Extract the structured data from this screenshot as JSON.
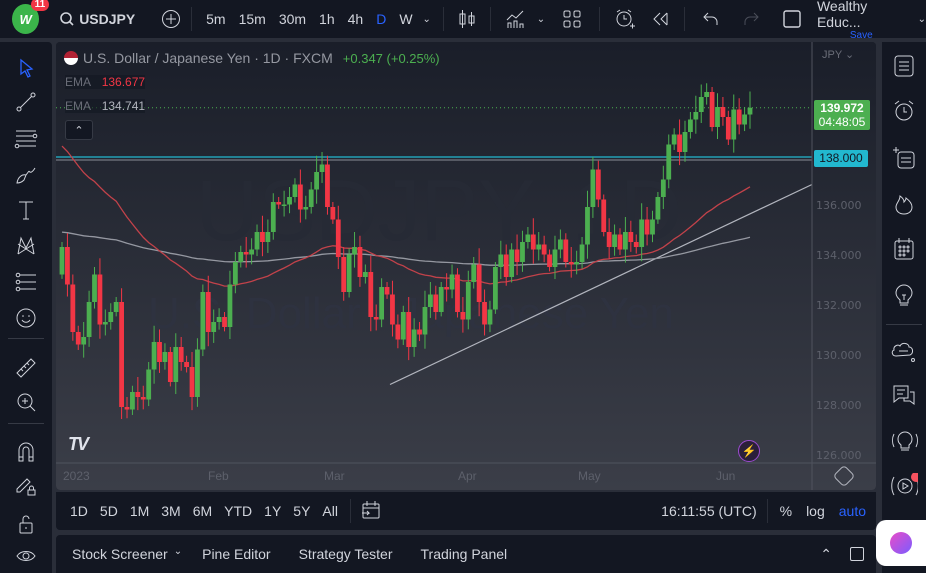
{
  "topbar": {
    "logo_badge": "11",
    "symbol": "USDJPY",
    "intervals": [
      "5m",
      "15m",
      "30m",
      "1h",
      "4h",
      "D",
      "W"
    ],
    "active_interval": "D",
    "layout_name": "Wealthy Educ...",
    "save_label": "Save"
  },
  "legend": {
    "title": "U.S. Dollar / Japanese Yen · 1D · FXCM",
    "change": "+0.347 (+0.25%)",
    "ema1_label": "EMA",
    "ema1_value": "136.677",
    "ema2_label": "EMA",
    "ema2_value": "134.741"
  },
  "watermark": {
    "line1": "USDJPY, 1D",
    "line2": "U.S. Dollar / Japanese Yen"
  },
  "price_axis": {
    "currency": "JPY",
    "labels": [
      "136.000",
      "134.000",
      "132.000",
      "130.000",
      "128.000",
      "126.000"
    ],
    "last_price": "139.972",
    "countdown": "04:48:05",
    "level_label": "138.000"
  },
  "time_axis": {
    "labels": [
      "2023",
      "Feb",
      "Mar",
      "Apr",
      "May",
      "Jun"
    ]
  },
  "colors": {
    "up": "#4caf50",
    "down": "#f23645",
    "ema_fast": "#c2424a",
    "ema_slow": "#9598a1",
    "level": "#22b8cf",
    "accent": "#2962ff"
  },
  "chart_data": {
    "type": "candlestick",
    "title": "USDJPY, 1D",
    "ylim": [
      125.5,
      141.5
    ],
    "level": 138.0,
    "trendline": [
      [
        128.9,
        0.42
      ],
      [
        136.9,
        1.0
      ]
    ],
    "ema_fast": {
      "period": 50,
      "seed": 138.6
    },
    "ema_slow": {
      "period": 200,
      "seed": 135.0
    },
    "open0": 133.3,
    "close": [
      134.4,
      132.9,
      131.0,
      130.5,
      130.8,
      132.2,
      133.3,
      131.3,
      131.4,
      131.8,
      132.2,
      128.0,
      127.9,
      128.6,
      128.4,
      128.3,
      129.5,
      130.6,
      129.8,
      130.2,
      129.0,
      130.4,
      129.8,
      129.6,
      128.4,
      130.3,
      132.6,
      131.0,
      131.4,
      131.6,
      131.2,
      132.9,
      133.8,
      134.2,
      134.1,
      134.3,
      135.0,
      134.6,
      135.0,
      136.2,
      136.1,
      136.1,
      136.4,
      136.9,
      135.9,
      136.0,
      136.7,
      137.4,
      137.7,
      136.0,
      135.5,
      134.0,
      132.6,
      134.1,
      134.4,
      133.2,
      133.4,
      131.6,
      131.5,
      132.8,
      132.5,
      131.3,
      130.7,
      131.8,
      130.4,
      131.1,
      130.9,
      132.0,
      132.5,
      131.8,
      132.8,
      132.7,
      133.3,
      131.8,
      131.5,
      133.0,
      133.7,
      132.2,
      131.3,
      131.9,
      133.6,
      134.1,
      133.2,
      134.3,
      133.8,
      134.6,
      134.9,
      134.3,
      134.5,
      134.1,
      133.6,
      134.3,
      134.7,
      133.8,
      133.7,
      133.8,
      134.5,
      136.0,
      137.5,
      136.3,
      135.0,
      134.4,
      134.9,
      134.3,
      135.0,
      134.6,
      134.4,
      135.5,
      134.9,
      135.5,
      136.4,
      137.1,
      138.5,
      138.9,
      138.2,
      139.0,
      139.5,
      139.8,
      140.4,
      140.6,
      139.2,
      140.0,
      139.6,
      138.7,
      139.9,
      139.3,
      139.7,
      139.97
    ]
  },
  "range_bar": {
    "ranges": [
      "1D",
      "5D",
      "1M",
      "3M",
      "6M",
      "YTD",
      "1Y",
      "5Y",
      "All"
    ],
    "clock": "16:11:55 (UTC)",
    "percent": "%",
    "log": "log",
    "auto": "auto"
  },
  "bottom_panel": {
    "tabs": [
      "Stock Screener",
      "Pine Editor",
      "Strategy Tester",
      "Trading Panel"
    ]
  }
}
